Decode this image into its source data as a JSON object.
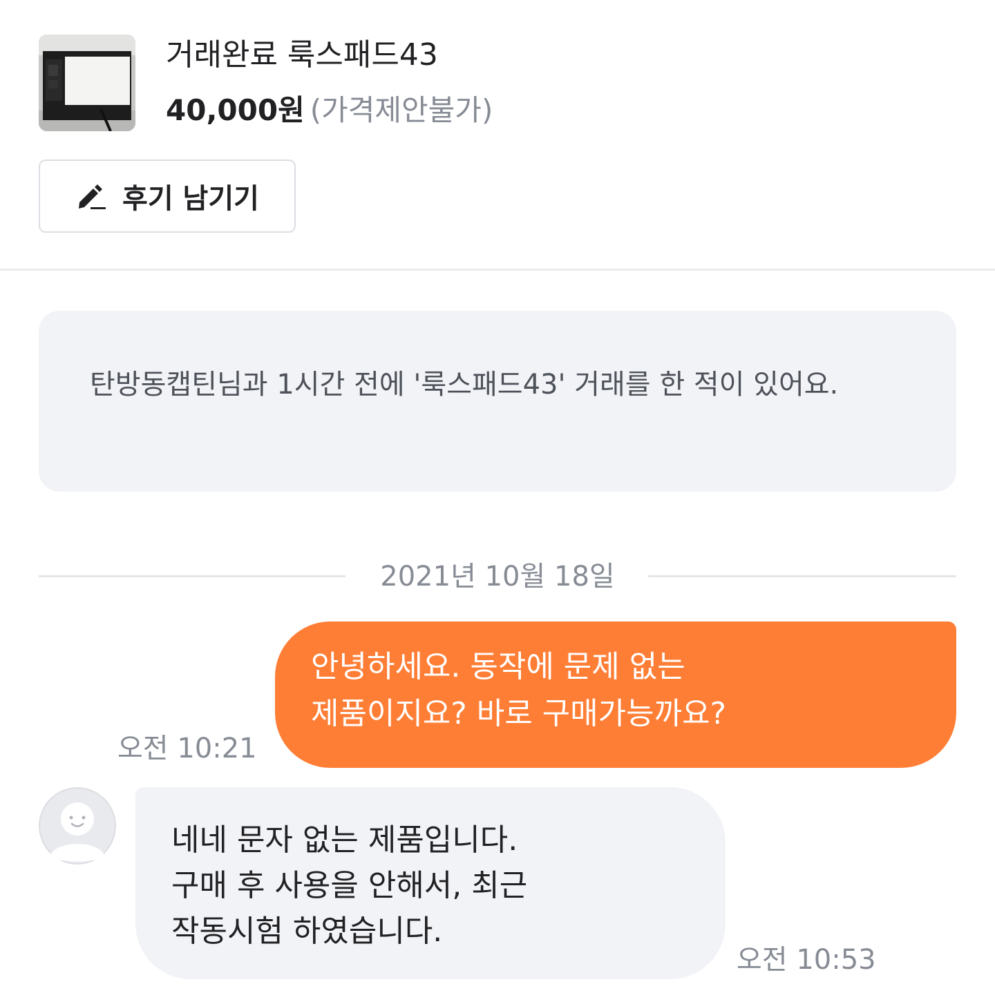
{
  "product": {
    "thumbnail_icon": "product-photo-lookspad",
    "title": "거래완료 룩스패드43",
    "price": "40,000원",
    "price_note": "(가격제안불가)"
  },
  "review_button": {
    "icon": "pencil-icon",
    "label": "후기 남기기"
  },
  "notice": {
    "text": "탄방동캡틴님과 1시간 전에 '룩스패드43' 거래를 한 적이 있어요."
  },
  "date_separator": {
    "label": "2021년 10월 18일"
  },
  "messages": [
    {
      "sender": "me",
      "lines": [
        "안녕하세요. 동작에 문제 없는",
        "제품이지요? 바로 구매가능까요?"
      ],
      "time": "오전 10:21",
      "bubble_color": "#ff7e36"
    },
    {
      "sender": "other",
      "avatar_icon": "default-profile-icon",
      "lines": [
        "네네 문자 없는 제품입니다.",
        "구매 후 사용을 안해서, 최근",
        "작동시험 하였습니다."
      ],
      "time": "오전 10:53",
      "bubble_color": "#f2f3f6"
    }
  ],
  "colors": {
    "accent": "#ff7e36",
    "muted_text": "#868b94",
    "bubble_gray": "#f2f3f6"
  }
}
